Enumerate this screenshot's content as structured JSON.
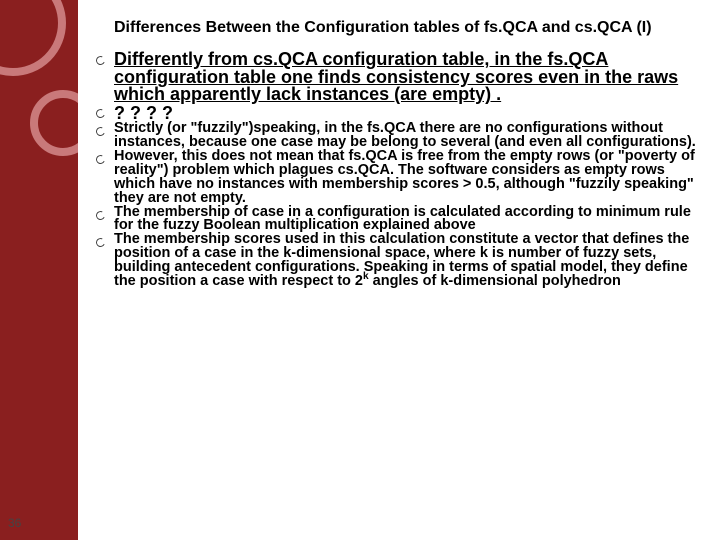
{
  "title": "Differences Between the Configuration tables of fs.QCA and cs.QCA (I)",
  "bullets": [
    {
      "cls": "b-large",
      "html": "Differently from cs.QCA configuration table, in the fs.QCA configuration table one finds consistency scores even in the raws which apparently lack instances (are empty) ."
    },
    {
      "cls": "b-q",
      "html": "? ? ? ?"
    },
    {
      "cls": "b-small",
      "html": "Strictly (or \"fuzzily\")speaking, in the fs.QCA there are no configurations without instances, because one case may be belong to several (and even all configurations)."
    },
    {
      "cls": "b-small",
      "html": "However, this does not mean that fs.QCA is free from the empty rows (or \"poverty of reality\") problem which plagues cs.QCA. The software considers as empty rows which have no instances with membership scores > 0.5, although \"fuzzily speaking\" they are not empty."
    },
    {
      "cls": "b-small",
      "html": "The membership of case in a configuration is calculated according to minimum rule for the fuzzy Boolean multiplication explained above"
    },
    {
      "cls": "b-small",
      "html": "The membership scores used in this calculation constitute a vector that defines the position of a case in the k-dimensional space, where k is number of fuzzy sets, building antecedent configurations.  Speaking in terms of spatial model, they define the position a case with respect to 2<sup>k</sup> angles of k-dimensional polyhedron"
    }
  ],
  "pagenum": "36"
}
